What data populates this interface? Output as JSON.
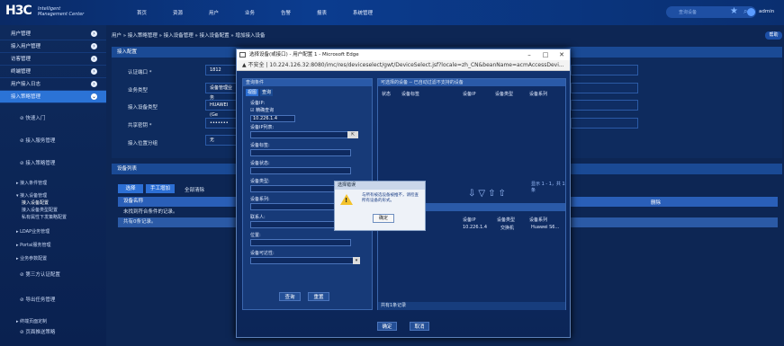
{
  "header": {
    "logo": "H3C",
    "logo_sub1": "Intelligent",
    "logo_sub2": "Management Center",
    "nav": [
      "首页",
      "资源",
      "用户",
      "业务",
      "告警",
      "报表",
      "系统管理"
    ],
    "search_placeholder": "查询设备",
    "user": "admin"
  },
  "sidebar": {
    "items": [
      "用户管理",
      "接入用户管理",
      "访客管理",
      "终端管理",
      "用户接入日志",
      "接入策略管理"
    ],
    "subs": [
      "快速入门",
      "接入服务管理",
      "接入策略管理"
    ],
    "tree": [
      "接入条件管理",
      "接入设备管理",
      "接入设备配置",
      "接入设备类型配置",
      "私有属性下发策略配置",
      "LDAP业务管理",
      "Portal服务管理",
      "业务参数配置"
    ],
    "bottom": [
      "第三方认证配置",
      "导出任务管理",
      "终端页面定制",
      "页面推送策略"
    ]
  },
  "main": {
    "breadcrumb": "用户 » 接入策略管理 » 接入设备管理 » 接入设备配置 » 增加接入设备",
    "help": "帮助",
    "config_title": "接入配置",
    "fields": {
      "port_label": "认证端口 *",
      "port_value": "1812",
      "biz_label": "业务类型",
      "biz_value": "设备管理业务",
      "devtype_label": "接入设备类型",
      "devtype_value": "HUAWEI (Ge",
      "secret_label": "共享密钥 *",
      "secret_value": "•••••••",
      "loc_label": "接入位置分组",
      "loc_value": "无"
    },
    "list_title": "设备列表",
    "buttons": {
      "select": "选择",
      "manual": "手工增加",
      "clear": "全部清除"
    },
    "table_head": "设备名称",
    "table_head_right": "删除",
    "empty_msg": "未找到符合条件的记录。",
    "total_msg": "共有0条记录。"
  },
  "popup": {
    "title": "选择设备(或接口) - 用户配置 1 - Microsoft Edge",
    "insecure": "不安全",
    "url": "10.224.126.32:8080/imc/res/deviceselect/gwt/DeviceSelect.jsf?locale=zh_CN&beanName=acmAccessDevi...",
    "query_title": "查询条件",
    "tabs": [
      "视图",
      "查询"
    ],
    "ip_label": "设备IP:",
    "fuzzy": "精确查询",
    "ip_value": "10.226.1.4",
    "iplist_label": "设备IP列表:",
    "tag_label": "设备标签:",
    "status_label": "设备状态:",
    "type_label": "设备类型:",
    "series_label": "设备系列:",
    "contact_label": "联系人:",
    "location_label": "位置:",
    "reach_label": "设备可达性:",
    "query_btn": "查询",
    "reset_btn": "重置",
    "right_title": "可选择的设备  -- 已自动过滤不支持的设备",
    "cols": [
      "状态",
      "设备标签",
      "设备IP",
      "设备类型",
      "设备系列"
    ],
    "paging": "显示 1 - 1，共 1 条",
    "sel_cols": [
      "设备IP",
      "设备类型",
      "设备系列"
    ],
    "sel_row": [
      "10.226.1.4",
      "交换机",
      "Huawei S6..."
    ],
    "sel_total": "共有1条记录",
    "ok": "确定",
    "cancel": "取消"
  },
  "alert": {
    "title": "选择错误",
    "message": "与所有被选设备被推不，请检查所有设备的形式。",
    "ok": "确定"
  }
}
